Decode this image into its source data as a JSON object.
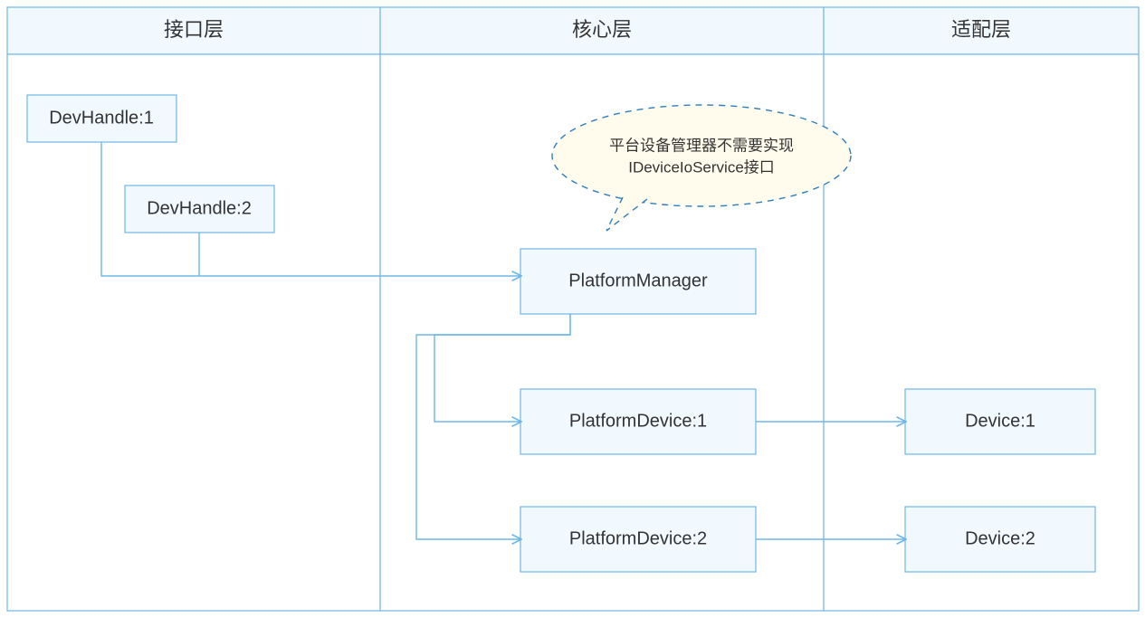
{
  "layers": {
    "interface": "接口层",
    "core": "核心层",
    "adapter": "适配层"
  },
  "nodes": {
    "devHandle1": "DevHandle:1",
    "devHandle2": "DevHandle:2",
    "platformManager": "PlatformManager",
    "platformDevice1": "PlatformDevice:1",
    "platformDevice2": "PlatformDevice:2",
    "device1": "Device:1",
    "device2": "Device:2"
  },
  "callout": {
    "line1": "平台设备管理器不需要实现",
    "line2": "IDeviceIoService接口"
  },
  "chart_data": {
    "type": "diagram",
    "title": "",
    "columns": [
      {
        "id": "interface",
        "label": "接口层"
      },
      {
        "id": "core",
        "label": "核心层"
      },
      {
        "id": "adapter",
        "label": "适配层"
      }
    ],
    "nodes": [
      {
        "id": "devHandle1",
        "label": "DevHandle:1",
        "column": "interface"
      },
      {
        "id": "devHandle2",
        "label": "DevHandle:2",
        "column": "interface"
      },
      {
        "id": "platformManager",
        "label": "PlatformManager",
        "column": "core"
      },
      {
        "id": "platformDevice1",
        "label": "PlatformDevice:1",
        "column": "core"
      },
      {
        "id": "platformDevice2",
        "label": "PlatformDevice:2",
        "column": "core"
      },
      {
        "id": "device1",
        "label": "Device:1",
        "column": "adapter"
      },
      {
        "id": "device2",
        "label": "Device:2",
        "column": "adapter"
      }
    ],
    "edges": [
      {
        "from": "devHandle1",
        "to": "platformManager"
      },
      {
        "from": "devHandle2",
        "to": "platformManager"
      },
      {
        "from": "platformManager",
        "to": "platformDevice1"
      },
      {
        "from": "platformManager",
        "to": "platformDevice2"
      },
      {
        "from": "platformDevice1",
        "to": "device1"
      },
      {
        "from": "platformDevice2",
        "to": "device2"
      }
    ],
    "annotations": [
      {
        "target": "platformManager",
        "text": "平台设备管理器不需要实现 IDeviceIoService接口"
      }
    ]
  }
}
